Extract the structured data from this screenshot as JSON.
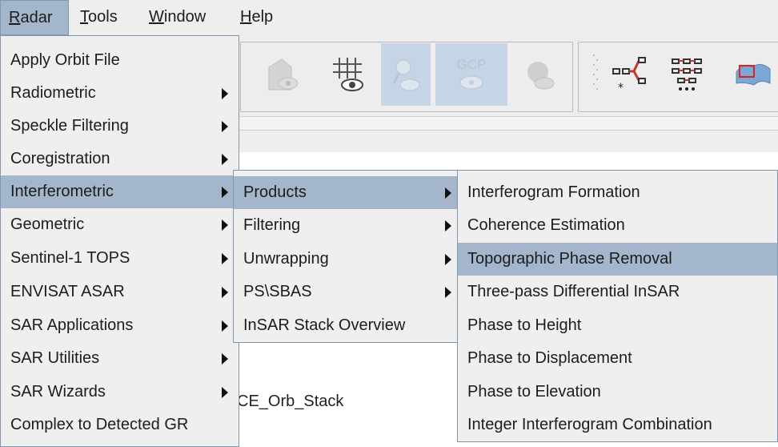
{
  "menubar": {
    "items": [
      {
        "label": "Radar",
        "mnemonic": "R",
        "rest": "adar"
      },
      {
        "label": "Tools",
        "mnemonic": "T",
        "rest": "ools"
      },
      {
        "label": "Window",
        "mnemonic": "W",
        "rest": "indow"
      },
      {
        "label": "Help",
        "mnemonic": "H",
        "rest": "elp"
      }
    ]
  },
  "toolbar": {
    "icons": [
      "view-disabled-icon",
      "grid-eye-icon",
      "pin-eye-icon",
      "gcp-eye-icon",
      "blob-eye-icon",
      "graph-builder-icon",
      "batch-graph-icon",
      "world-map-icon"
    ],
    "gcp_label": "GCP"
  },
  "background_text": "CE_Orb_Stack",
  "radar_menu": {
    "items": [
      {
        "label": "Apply Orbit File",
        "submenu": false
      },
      {
        "label": "Radiometric",
        "submenu": true
      },
      {
        "label": "Speckle Filtering",
        "submenu": true
      },
      {
        "label": "Coregistration",
        "submenu": true
      },
      {
        "label": "Interferometric",
        "submenu": true
      },
      {
        "label": "Geometric",
        "submenu": true
      },
      {
        "label": "Sentinel-1 TOPS",
        "submenu": true
      },
      {
        "label": "ENVISAT ASAR",
        "submenu": true
      },
      {
        "label": "SAR Applications",
        "submenu": true
      },
      {
        "label": "SAR Utilities",
        "submenu": true
      },
      {
        "label": "SAR Wizards",
        "submenu": true
      },
      {
        "label": "Complex to Detected GR",
        "submenu": false
      }
    ],
    "highlighted": "Interferometric"
  },
  "interferometric_menu": {
    "items": [
      {
        "label": "Products",
        "submenu": true
      },
      {
        "label": "Filtering",
        "submenu": true
      },
      {
        "label": "Unwrapping",
        "submenu": true
      },
      {
        "label": "PS\\SBAS",
        "submenu": true
      },
      {
        "label": "InSAR Stack Overview",
        "submenu": false
      }
    ],
    "highlighted": "Products"
  },
  "products_menu": {
    "items": [
      {
        "label": "Interferogram Formation"
      },
      {
        "label": "Coherence Estimation"
      },
      {
        "label": "Topographic Phase Removal"
      },
      {
        "label": "Three-pass Differential InSAR"
      },
      {
        "label": "Phase to Height"
      },
      {
        "label": "Phase to Displacement"
      },
      {
        "label": "Phase to Elevation"
      },
      {
        "label": "Integer Interferogram Combination"
      }
    ],
    "highlighted": "Topographic Phase Removal"
  },
  "colors": {
    "menu_highlight": "#a3b6cc",
    "menu_border": "#7f97b2",
    "menu_bg": "#efefef"
  }
}
